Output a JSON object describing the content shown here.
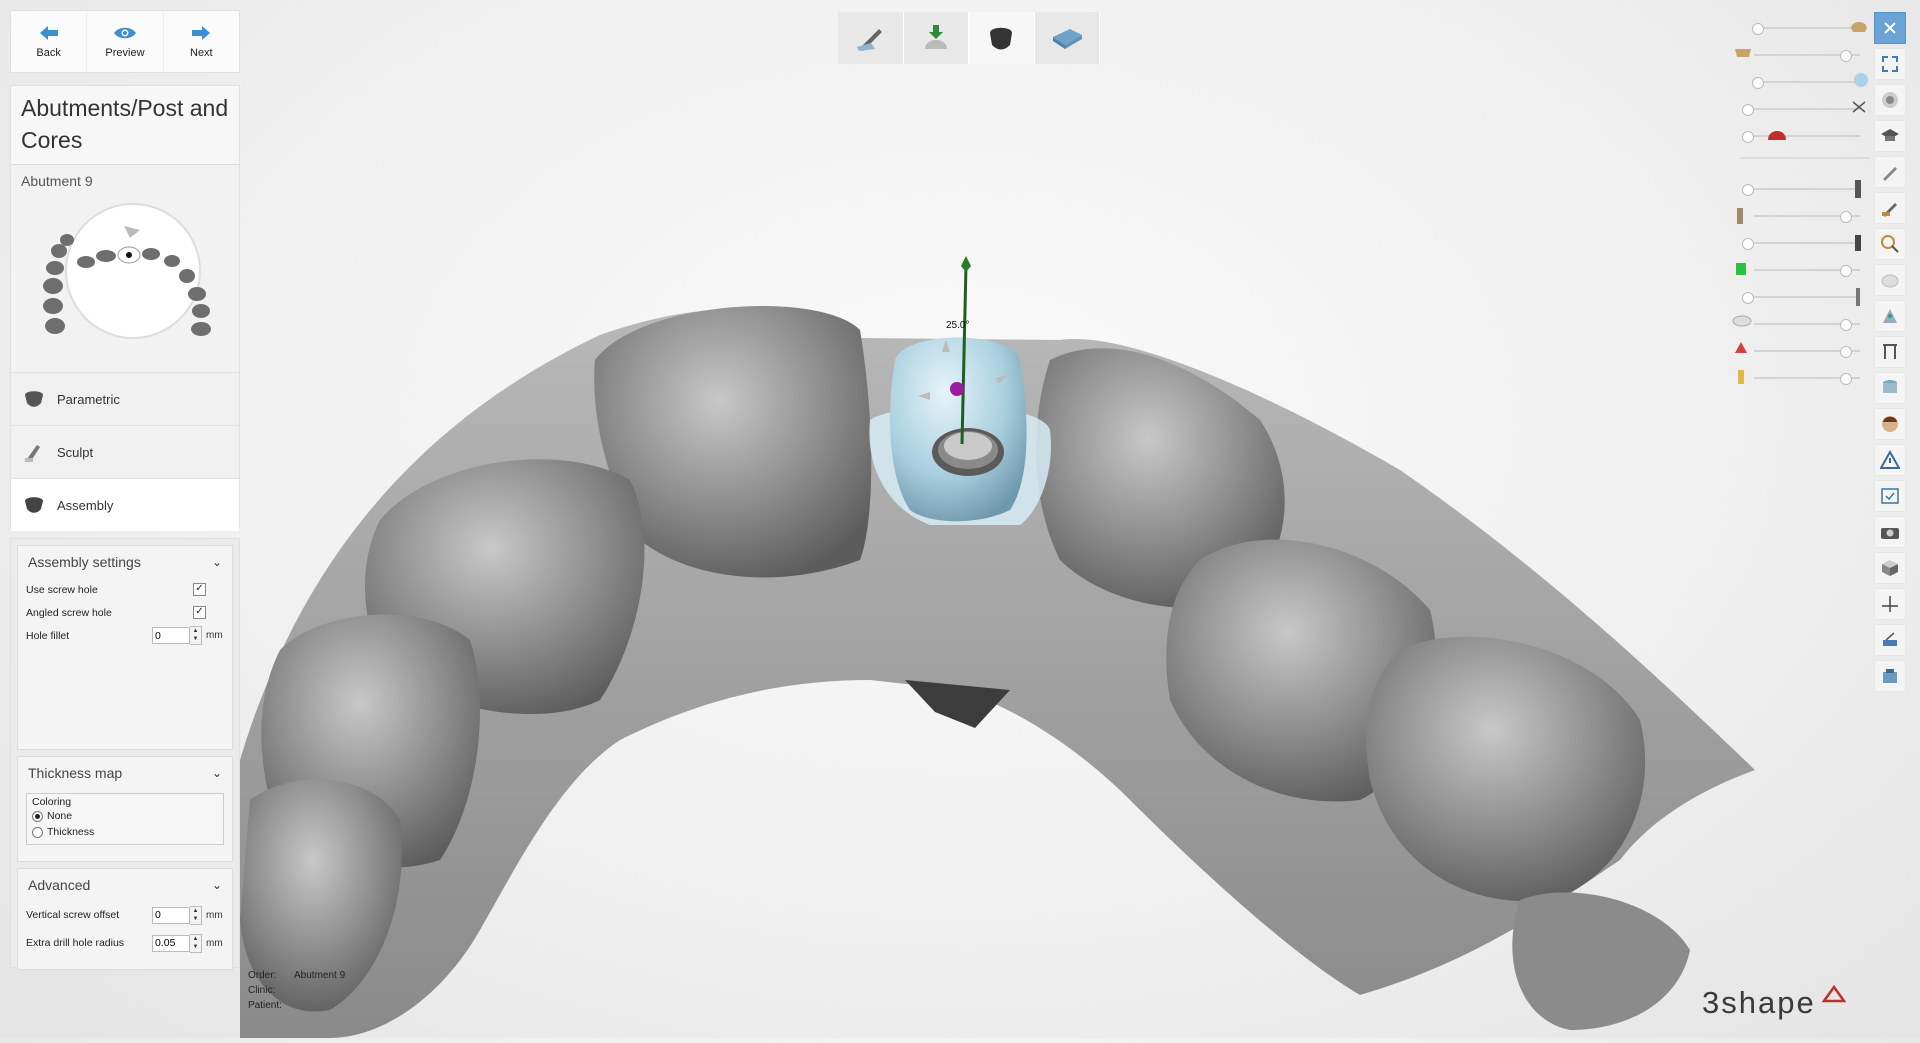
{
  "nav": {
    "back": "Back",
    "preview": "Preview",
    "next": "Next"
  },
  "header": {
    "title": "Abutments/Post and Cores",
    "subtitle": "Abutment 9"
  },
  "steps": [
    {
      "label": "Parametric",
      "icon": "abutment-icon"
    },
    {
      "label": "Sculpt",
      "icon": "sculpt-tool-icon"
    },
    {
      "label": "Assembly",
      "icon": "assembly-icon"
    }
  ],
  "assembly_settings": {
    "title": "Assembly settings",
    "use_screw_hole_label": "Use screw hole",
    "use_screw_hole": true,
    "angled_screw_hole_label": "Angled screw hole",
    "angled_screw_hole": true,
    "hole_fillet_label": "Hole fillet",
    "hole_fillet_value": "0",
    "unit": "mm"
  },
  "thickness_map": {
    "title": "Thickness map",
    "coloring_label": "Coloring",
    "options": [
      "None",
      "Thickness"
    ],
    "selected": "None"
  },
  "advanced": {
    "title": "Advanced",
    "vertical_offset_label": "Vertical screw offset",
    "vertical_offset_value": "0",
    "extra_drill_label": "Extra drill hole radius",
    "extra_drill_value": "0.05",
    "unit": "mm"
  },
  "viewport": {
    "angle_label": "25.0°"
  },
  "info": {
    "order_label": "Order:",
    "order_value": "Abutment 9",
    "clinic_label": "Clinic:",
    "clinic_value": "",
    "patient_label": "Patient:",
    "patient_value": ""
  },
  "logo": "3shape",
  "top_toolbar": [
    "design-pen-icon",
    "scan-import-icon",
    "abutment-tool-icon",
    "model-plate-icon"
  ],
  "right_rail": [
    "close-icon",
    "fullscreen-icon",
    "view-orientation-icon",
    "education-cap-icon",
    "cut-plane-icon",
    "sculpt-brush-icon",
    "magnify-icon",
    "transparency-icon",
    "measure-icon",
    "cross-section-icon",
    "cylinder-icon",
    "face-icon",
    "warning-icon",
    "check-window-icon",
    "camera-icon",
    "cube-view-icon",
    "axis-icon",
    "notes-icon",
    "scanner-icon"
  ],
  "colors": {
    "accent": "#3a8fd0",
    "rail_active": "#6aa4d6",
    "model_gray": "#9a9a9a",
    "abutment": "#bfe0ec"
  }
}
